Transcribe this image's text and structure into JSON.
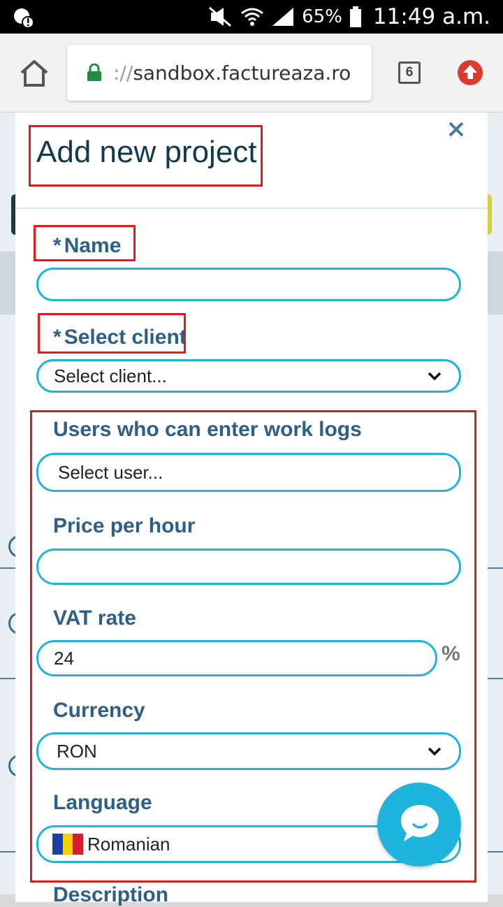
{
  "status_bar": {
    "battery_percent": "65%",
    "time": "11:49 a.m."
  },
  "browser": {
    "url_scheme": "://",
    "url_host": "sandbox.factureaza.ro",
    "tab_count": "6"
  },
  "modal": {
    "title": "Add new project",
    "fields": {
      "name": {
        "required_mark": "*",
        "label": "Name",
        "value": ""
      },
      "client": {
        "required_mark": "*",
        "label": "Select client",
        "value": "Select client..."
      },
      "users": {
        "label": "Users who can enter work logs",
        "value": "Select user..."
      },
      "price": {
        "label": "Price per hour",
        "value": ""
      },
      "vat": {
        "label": "VAT rate",
        "value": "24",
        "unit": "%"
      },
      "currency": {
        "label": "Currency",
        "value": "RON"
      },
      "language": {
        "label": "Language",
        "value": "Romanian"
      },
      "description": {
        "label": "Description"
      }
    }
  },
  "colors": {
    "accent": "#1eb4dc",
    "label": "#2d5f87",
    "title": "#123a4f",
    "highlight": "#e01b1b"
  },
  "icons": [
    "notification-icon",
    "mute-icon",
    "wifi-icon",
    "signal-icon",
    "battery-icon",
    "home-icon",
    "lock-icon",
    "tabs-icon",
    "update-icon",
    "close-icon",
    "chevron-down-icon",
    "romania-flag-icon",
    "chat-icon"
  ]
}
